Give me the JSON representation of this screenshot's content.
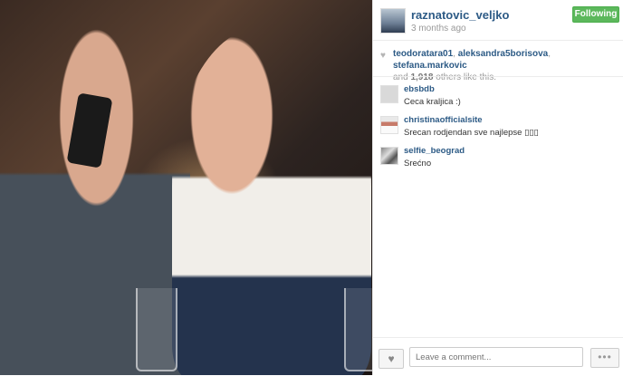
{
  "post": {
    "username": "raznatovic_veljko",
    "time": "3 months ago",
    "follow_label": "Following"
  },
  "likes": {
    "user1": "teodoratara01",
    "user2": "aleksandra5borisova",
    "user3": "stefana.markovic",
    "and_text": "and",
    "count": "1,918",
    "suffix": "others like this."
  },
  "comments": [
    {
      "user": "ebsbdb",
      "text": "Ceca kraljica :)",
      "avatar": "blank-avatar"
    },
    {
      "user": "christinaofficialsite",
      "text": "Srecan rodjendan sve najlepse ▯▯▯",
      "avatar": "person-avatar"
    },
    {
      "user": "selfie_beograd",
      "text": "Srećno",
      "avatar": "group-avatar"
    }
  ],
  "footer": {
    "comment_placeholder": "Leave a comment...",
    "like_icon": "heart-icon",
    "more_icon": "ellipsis-icon"
  },
  "colors": {
    "link": "#2c5a85",
    "follow_green": "#5cb85c"
  }
}
